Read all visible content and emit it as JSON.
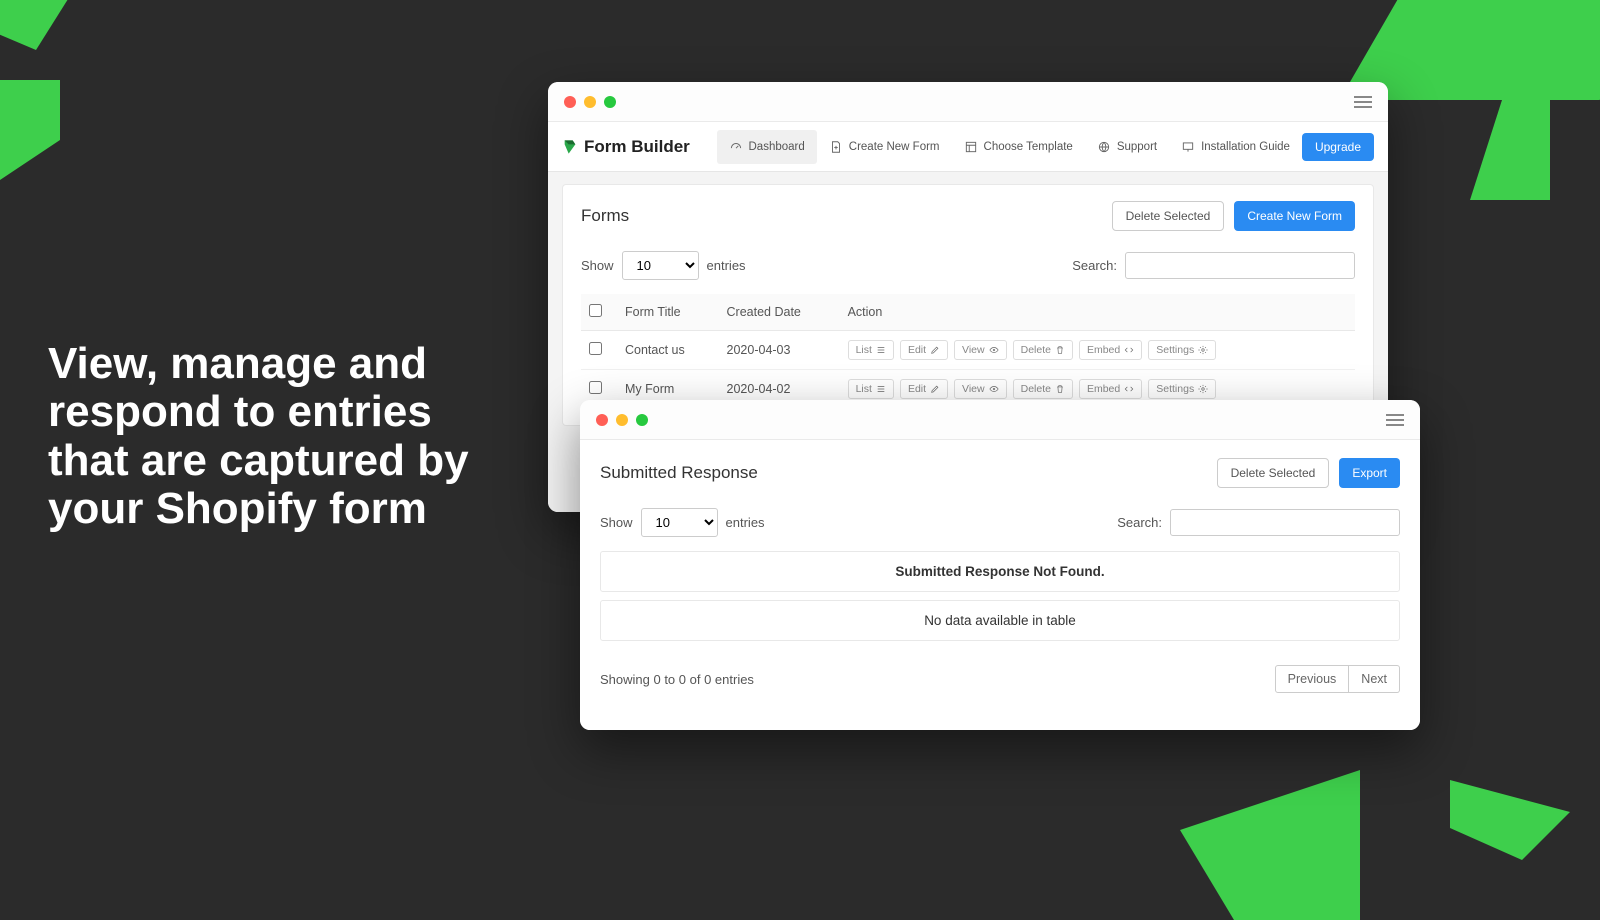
{
  "marketing": {
    "headline": "View, manage and respond to entries that are captured by your Shopify form"
  },
  "window1": {
    "brand": "Form Builder",
    "nav": {
      "dashboard": "Dashboard",
      "create": "Create New Form",
      "template": "Choose Template",
      "support": "Support",
      "guide": "Installation Guide",
      "upgrade": "Upgrade"
    },
    "forms": {
      "title": "Forms",
      "delete_selected": "Delete Selected",
      "create_new": "Create New Form",
      "show_label": "Show",
      "show_value": "10",
      "entries_label": "entries",
      "search_label": "Search:",
      "cols": {
        "check": "",
        "title": "Form Title",
        "date": "Created Date",
        "action": "Action"
      },
      "rows": [
        {
          "title": "Contact us",
          "date": "2020-04-03"
        },
        {
          "title": "My Form",
          "date": "2020-04-02"
        }
      ],
      "actions": {
        "list": "List",
        "edit": "Edit",
        "view": "View",
        "delete": "Delete",
        "embed": "Embed",
        "settings": "Settings"
      }
    }
  },
  "window2": {
    "title": "Submitted Response",
    "delete_selected": "Delete Selected",
    "export": "Export",
    "show_label": "Show",
    "show_value": "10",
    "entries_label": "entries",
    "search_label": "Search:",
    "empty_title": "Submitted Response Not Found.",
    "empty_sub": "No data available in table",
    "showing": "Showing 0 to 0 of 0 entries",
    "prev": "Previous",
    "next": "Next"
  }
}
